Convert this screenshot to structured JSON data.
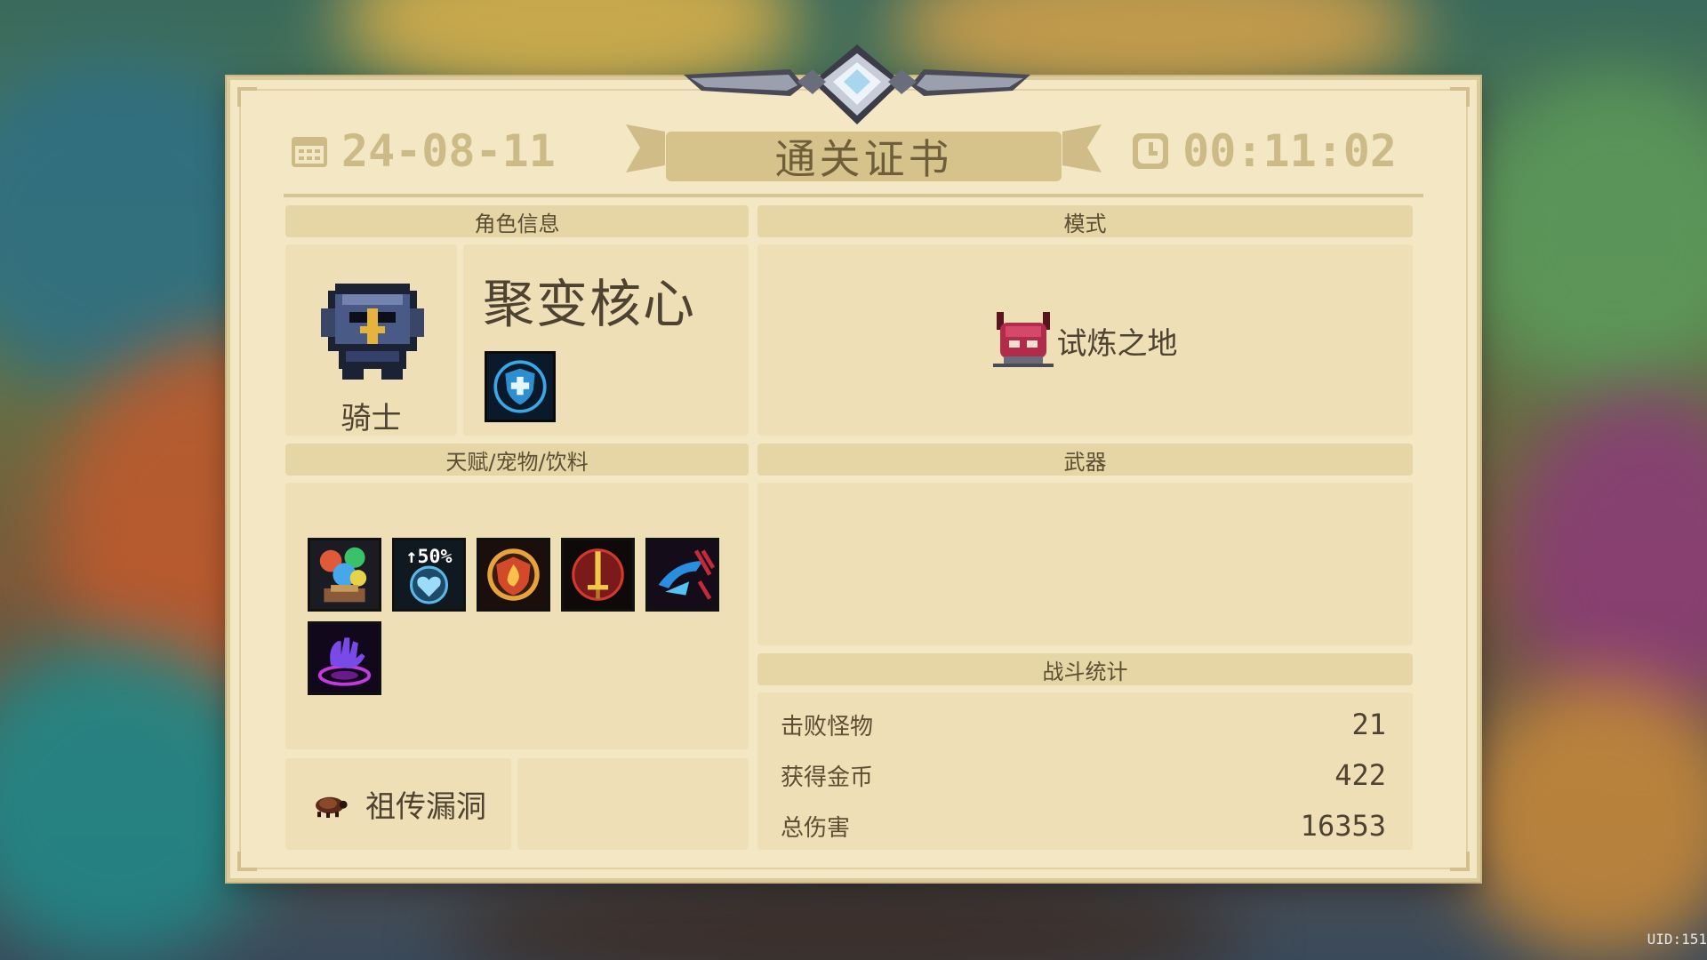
{
  "background": {
    "uid_text": "UID:151"
  },
  "certificate": {
    "date": "24-08-11",
    "time": "00:11:02",
    "title": "通关证书"
  },
  "sections": {
    "character_info": "角色信息",
    "mode": "模式",
    "talents_pets_drinks": "天赋/宠物/饮料",
    "weapons": "武器",
    "battle_stats": "战斗统计"
  },
  "character": {
    "name": "骑士",
    "build_title": "聚变核心",
    "skill_icon": "shield-cross-icon"
  },
  "mode": {
    "label": "试炼之地",
    "icon": "horned-demon-helmet-icon"
  },
  "talent_items": [
    {
      "icon": "elemental-orbs-icon"
    },
    {
      "icon": "heart-shield-plus50-icon",
      "overlay_text": "↑50%"
    },
    {
      "icon": "fire-shield-badge-icon"
    },
    {
      "icon": "red-sword-circle-icon"
    },
    {
      "icon": "blue-dash-claw-icon"
    },
    {
      "icon": "purple-hand-portal-icon"
    }
  ],
  "weapons": [],
  "bug": {
    "label": "祖传漏洞",
    "icon": "beetle-icon"
  },
  "stats": [
    {
      "label": "击败怪物",
      "value": "21"
    },
    {
      "label": "获得金币",
      "value": "422"
    },
    {
      "label": "总伤害",
      "value": "16353"
    }
  ],
  "colors": {
    "panel": "#f3e7c4",
    "header_bar": "#e6d6a6",
    "box": "#eedfb6",
    "faded_text": "#cdbb87",
    "dark_text": "#4e4230"
  }
}
